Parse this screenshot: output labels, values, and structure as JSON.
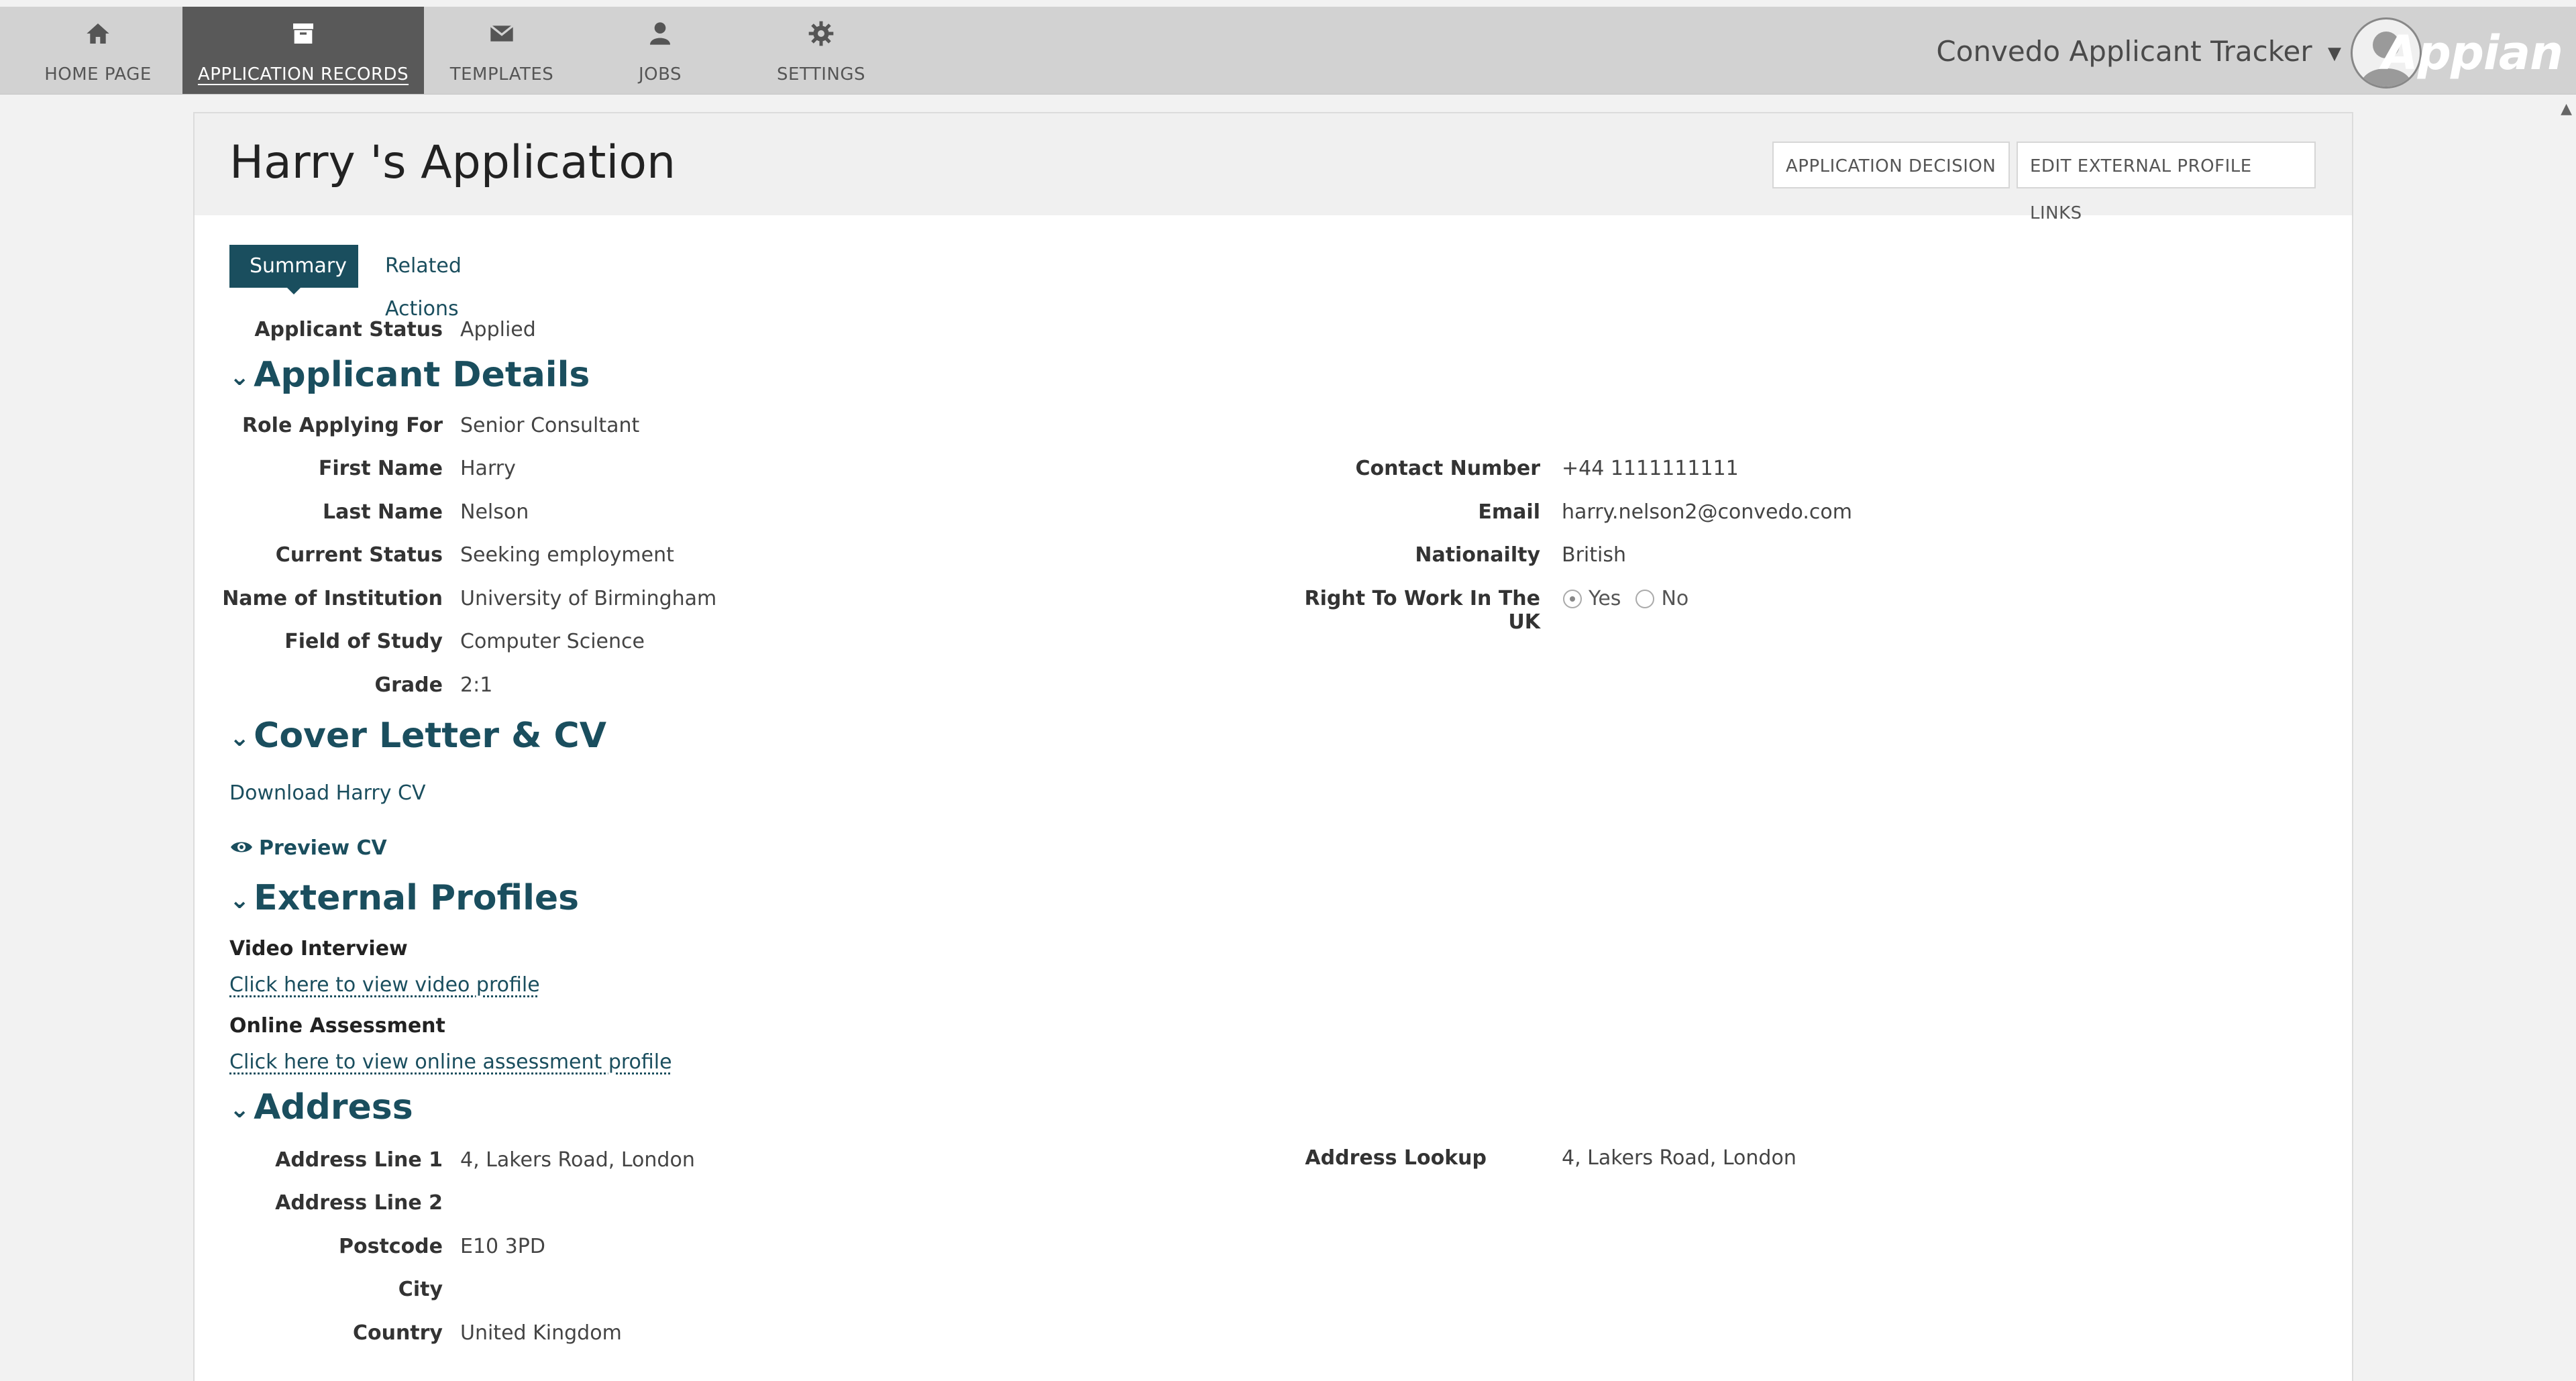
{
  "nav": {
    "items": [
      {
        "label": "HOME PAGE",
        "icon": "home-icon"
      },
      {
        "label": "APPLICATION RECORDS",
        "icon": "archive-box-icon"
      },
      {
        "label": "TEMPLATES",
        "icon": "envelope-icon"
      },
      {
        "label": "JOBS",
        "icon": "person-icon"
      },
      {
        "label": "SETTINGS",
        "icon": "gear-icon"
      }
    ],
    "active": "APPLICATION RECORDS"
  },
  "header": {
    "app_name": "Convedo Applicant Tracker",
    "brand": "Appian"
  },
  "record": {
    "title": "Harry 's Application",
    "actions": {
      "decision": "APPLICATION DECISION",
      "edit_links": "EDIT EXTERNAL PROFILE LINKS"
    },
    "tabs": {
      "summary": "Summary",
      "related": "Related Actions"
    }
  },
  "status": {
    "label": "Applicant Status",
    "value": "Applied"
  },
  "sections": {
    "applicant_details": "Applicant Details",
    "cover_letter": "Cover Letter & CV",
    "external_profiles": "External Profiles",
    "address": "Address"
  },
  "applicant": {
    "left": [
      {
        "label": "Role Applying For",
        "value": "Senior Consultant"
      },
      {
        "label": "First Name",
        "value": "Harry"
      },
      {
        "label": "Last Name",
        "value": "Nelson"
      },
      {
        "label": "Current Status",
        "value": "Seeking employment"
      },
      {
        "label": "Name of Institution",
        "value": "University of Birmingham"
      },
      {
        "label": "Field of Study",
        "value": "Computer Science"
      },
      {
        "label": "Grade",
        "value": "2:1"
      }
    ],
    "right": [
      {
        "label": "Contact Number",
        "value": "+44 1111111111"
      },
      {
        "label": "Email",
        "value": "harry.nelson2@convedo.com"
      },
      {
        "label": "Nationailty",
        "value": "British"
      }
    ],
    "right_to_work": {
      "label_line1": "Right To Work In The",
      "label_line2": "UK",
      "options": [
        "Yes",
        "No"
      ],
      "selected": "Yes"
    }
  },
  "cv": {
    "download": "Download Harry CV",
    "preview": "Preview CV"
  },
  "profiles": {
    "video_label": "Video Interview",
    "video_link": "Click here to view video profile",
    "assessment_label": "Online Assessment",
    "assessment_link": "Click here to view online assessment profile"
  },
  "address": {
    "left": [
      {
        "label": "Address Line 1",
        "value": "4, Lakers Road, London"
      },
      {
        "label": "Address Line 2",
        "value": ""
      },
      {
        "label": "Postcode",
        "value": "E10 3PD"
      },
      {
        "label": "City",
        "value": ""
      },
      {
        "label": "Country",
        "value": "United Kingdom"
      }
    ],
    "lookup": {
      "label": "Address Lookup",
      "value": "4, Lakers Road, London"
    }
  },
  "colors": {
    "accent": "#1a4e5e",
    "nav_active": "#595959",
    "topbar": "#d2d2d2"
  }
}
